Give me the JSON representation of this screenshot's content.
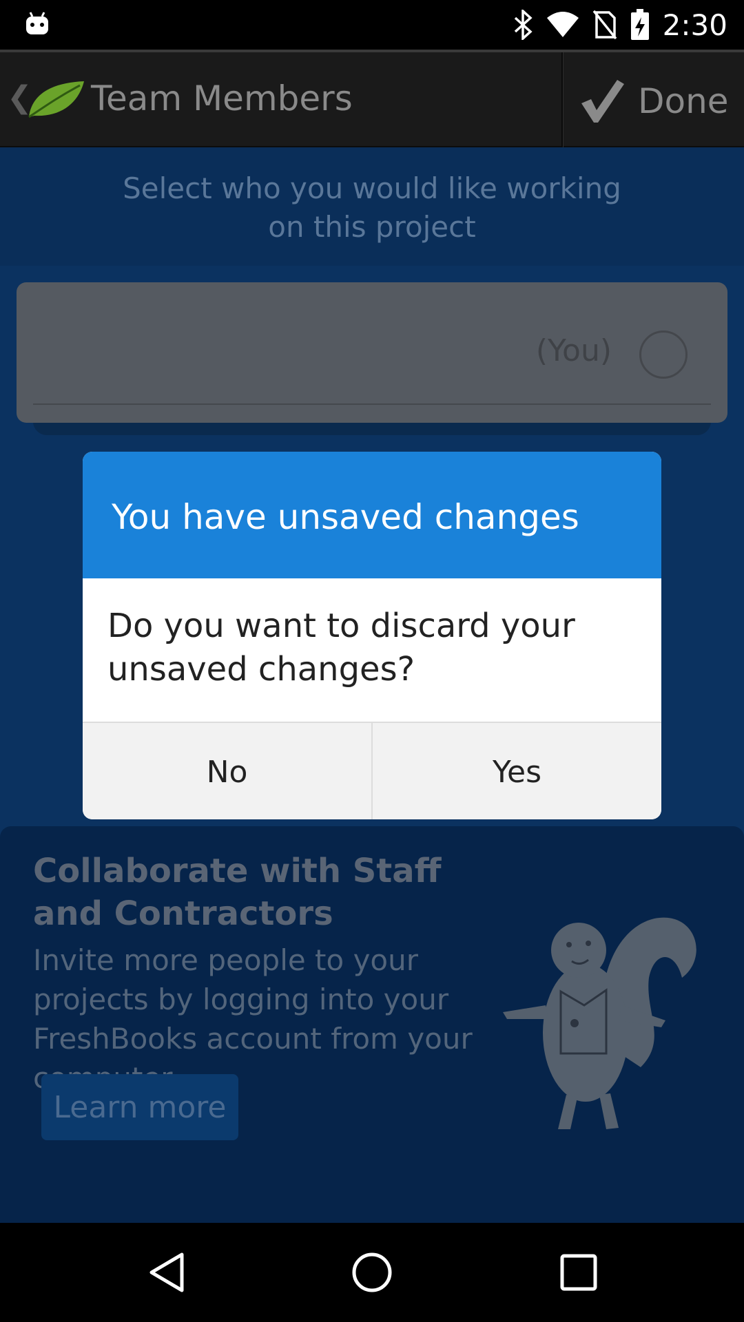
{
  "status_bar": {
    "time": "2:30",
    "icons": [
      "android-debug-icon",
      "bluetooth-icon",
      "wifi-icon",
      "no-sim-icon",
      "battery-charging-icon"
    ]
  },
  "action_bar": {
    "title": "Team Members",
    "done_label": "Done"
  },
  "instruction": {
    "line1": "Select who you would like working",
    "line2": "on this project"
  },
  "member": {
    "you_label": "(You)"
  },
  "promo": {
    "title": "Collaborate with Staff and Contractors",
    "body": "Invite more people to your projects by logging into your FreshBooks account from your computer.",
    "button_label": "Learn more"
  },
  "dialog": {
    "title": "You have unsaved changes",
    "message": "Do you want to discard your unsaved changes?",
    "no_label": "No",
    "yes_label": "Yes"
  },
  "colors": {
    "dialog_header": "#1a82d9",
    "accent_leaf": "#6aa32a"
  }
}
